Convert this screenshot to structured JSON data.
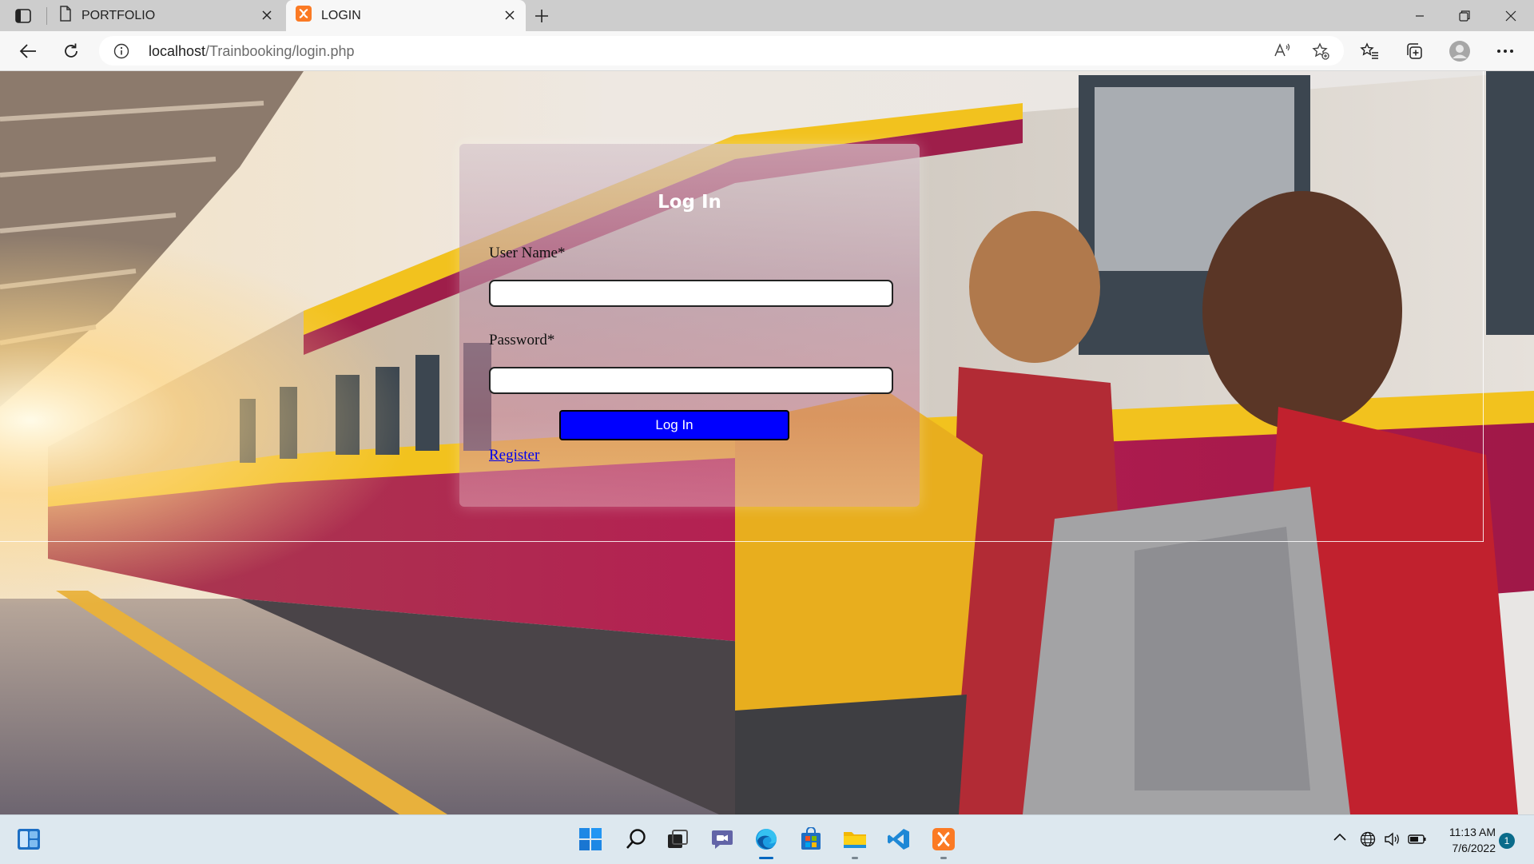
{
  "browser": {
    "tabs": [
      {
        "title": "PORTFOLIO",
        "active": false
      },
      {
        "title": "LOGIN",
        "active": true
      }
    ],
    "address": {
      "host": "localhost",
      "path": "/Trainbooking/login.php"
    }
  },
  "login": {
    "title": "Log In",
    "username_label": "User Name*",
    "username_value": "",
    "password_label": "Password*",
    "password_value": "",
    "submit_label": "Log In",
    "register_link": "Register"
  },
  "taskbar": {
    "apps": [
      "start-icon",
      "search-icon",
      "task-view-icon",
      "teams-chat-icon",
      "edge-icon",
      "store-icon",
      "file-explorer-icon",
      "vscode-icon",
      "xampp-icon"
    ],
    "clock_time": "11:13 AM",
    "clock_date": "7/6/2022",
    "notification_count": "1"
  },
  "colors": {
    "button_blue": "#0000ff",
    "link_blue": "#0000ee",
    "xampp_orange": "#fb7a24"
  }
}
